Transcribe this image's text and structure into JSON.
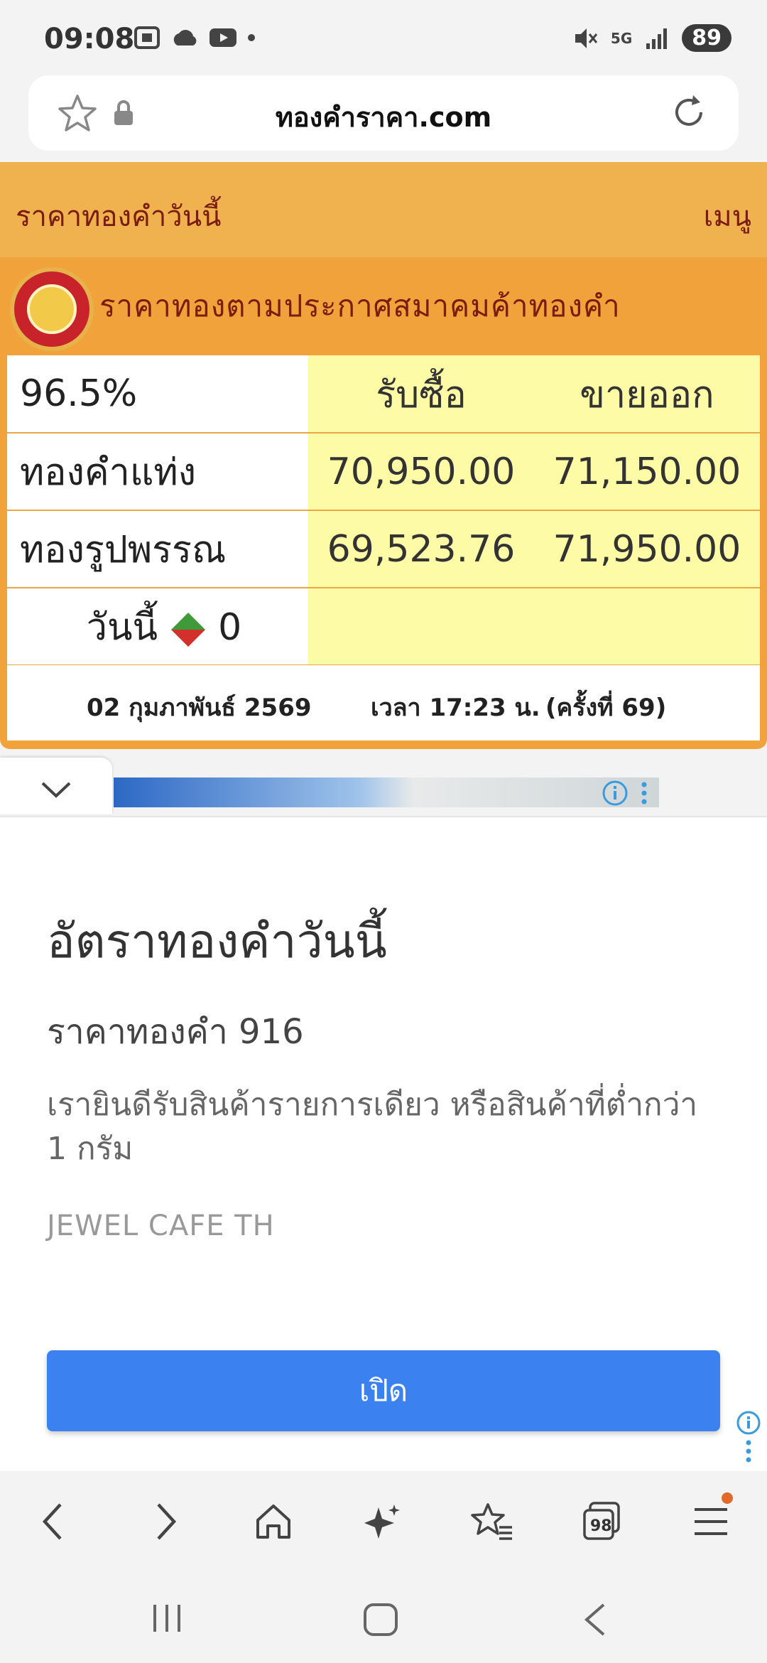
{
  "status": {
    "time": "09:08",
    "network": "5G",
    "battery": "89"
  },
  "browser": {
    "url": "ทองคำราคา.com",
    "tab_count": "98"
  },
  "header": {
    "title": "ราคาทองคำวันนี้",
    "menu": "เมนู"
  },
  "gold": {
    "association_title": "ราคาทองตามประกาศสมาคมค้าทองคำ",
    "purity": "96.5%",
    "col_buy": "รับซื้อ",
    "col_sell": "ขายออก",
    "rows": [
      {
        "label": "ทองคำแท่ง",
        "buy": "70,950.00",
        "sell": "71,150.00"
      },
      {
        "label": "ทองรูปพรรณ",
        "buy": "69,523.76",
        "sell": "71,950.00"
      }
    ],
    "today_label": "วันนี้",
    "today_change": "0",
    "date": "02 กุมภาพันธ์ 2569",
    "time": "เวลา 17:23 น.",
    "round": "(ครั้งที่ 69)"
  },
  "ad": {
    "title": "อัตราทองคำวันนี้",
    "subtitle": "ราคาทองคำ 916",
    "description": "เรายินดีรับสินค้ารายการเดียว หรือสินค้าที่ต่ำกว่า 1 กรัม",
    "brand": "JEWEL CAFE TH",
    "open_button": "เปิด"
  },
  "colors": {
    "header_bg": "#f0b24f",
    "card_bg": "#f2a23a",
    "price_bg": "#fdfba6",
    "title_text": "#7a1c10",
    "button_blue": "#3b82f0"
  }
}
